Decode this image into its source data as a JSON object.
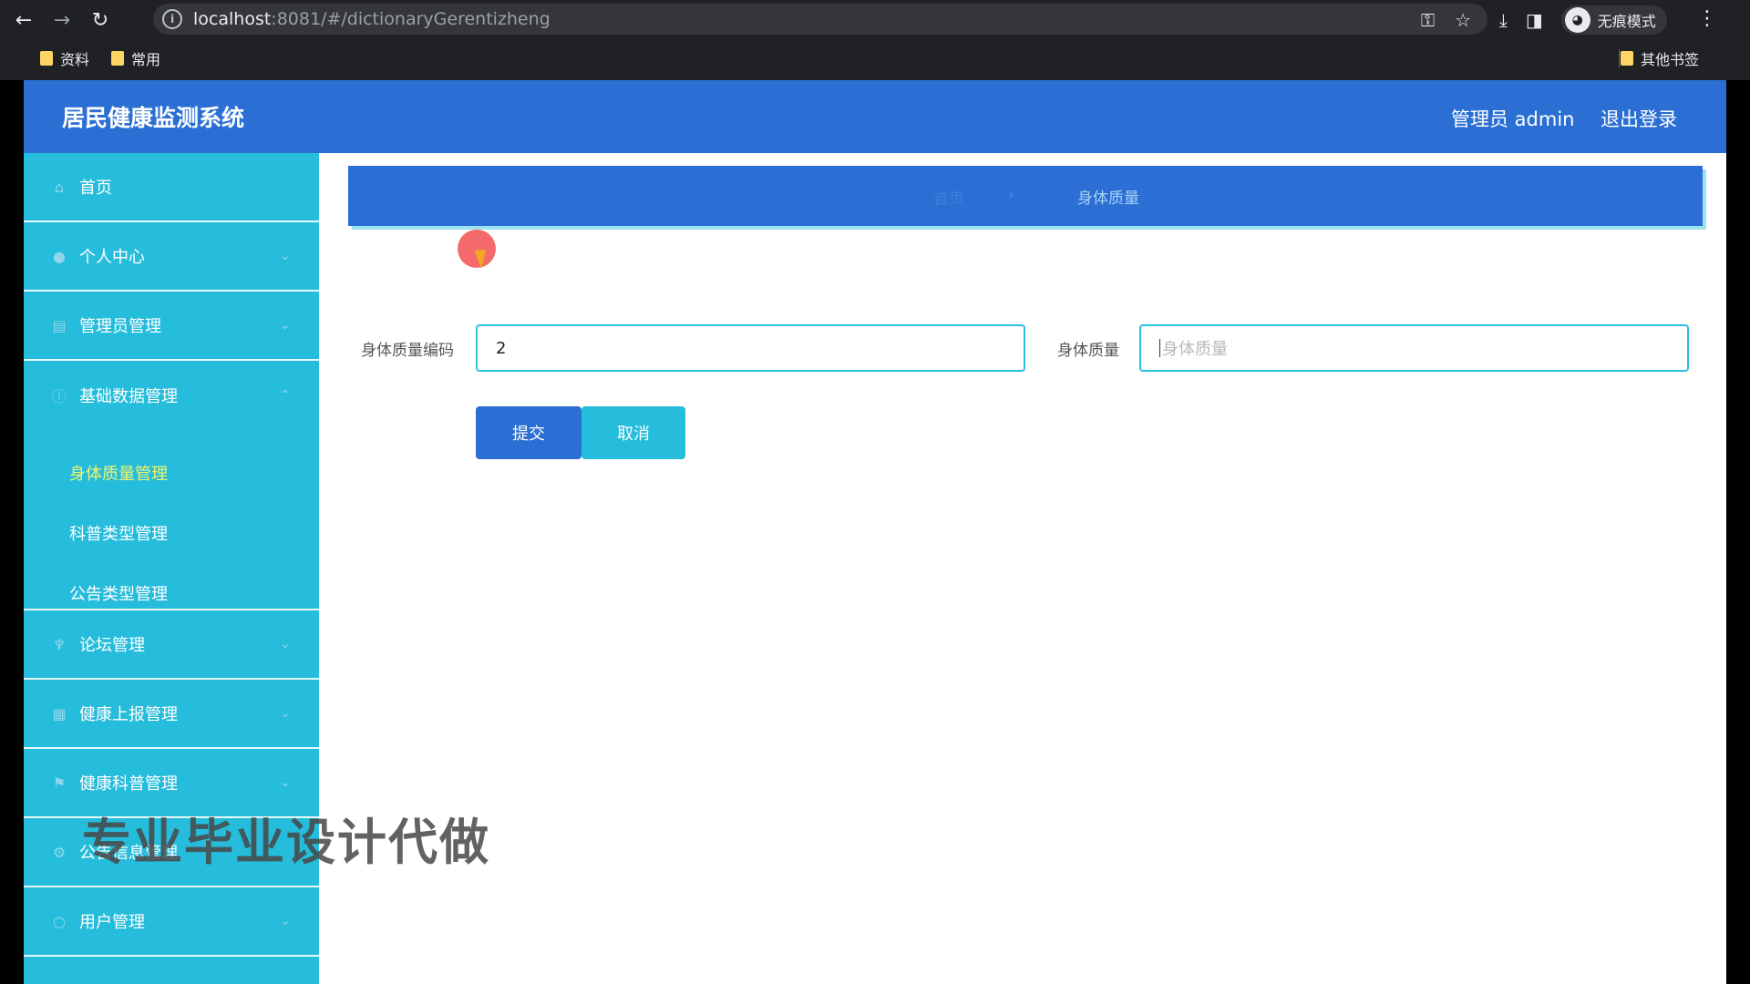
{
  "browser": {
    "url_host": "localhost",
    "url_rest": ":8081/#/dictionaryGerentizheng",
    "incognito_label": "无痕模式",
    "bookmarks": [
      "资料",
      "常用"
    ],
    "other_bookmarks": "其他书签"
  },
  "header": {
    "title": "居民健康监测系统",
    "user": "管理员 admin",
    "logout": "退出登录"
  },
  "sidebar": {
    "home": "首页",
    "personal_center": "个人中心",
    "admin_management": "管理员管理",
    "basic_data_management": "基础数据管理",
    "submenu": {
      "body_quality": "身体质量管理",
      "science_type": "科普类型管理",
      "notice_type": "公告类型管理"
    },
    "forum_management": "论坛管理",
    "health_report_management": "健康上报管理",
    "health_science_management": "健康科普管理",
    "notice_management": "公告信息管理",
    "user_management": "用户管理"
  },
  "breadcrumb": {
    "faded": "首页",
    "current": "身体质量"
  },
  "form": {
    "code_label": "身体质量编码",
    "code_value": "2",
    "quality_label": "身体质量",
    "quality_placeholder": "身体质量",
    "submit": "提交",
    "cancel": "取消"
  },
  "overlay": {
    "watermark": "专业毕业设计代做"
  },
  "colors": {
    "header_blue": "#2b6fd4",
    "sidebar_cyan": "#26bcdb",
    "active_submenu": "#f1f46a"
  }
}
